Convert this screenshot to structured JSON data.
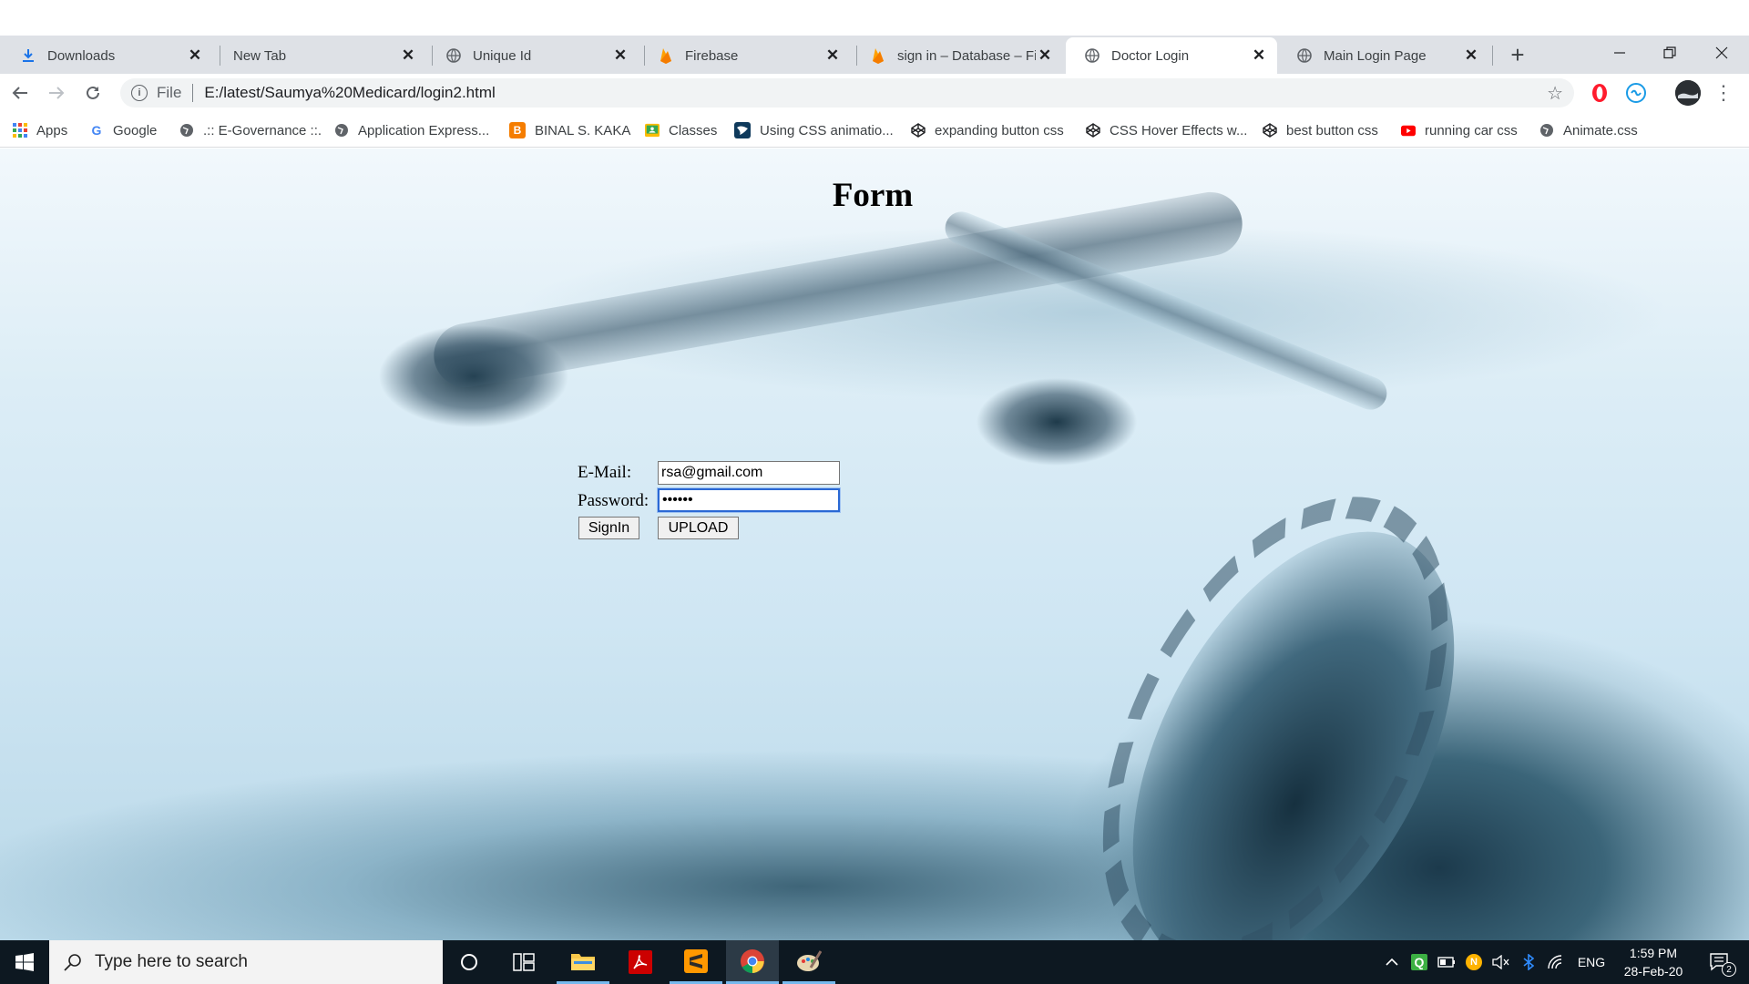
{
  "browser": {
    "tabs": [
      {
        "title": "Downloads",
        "icon": "download-icon"
      },
      {
        "title": "New Tab",
        "icon": "none"
      },
      {
        "title": "Unique Id",
        "icon": "globe-icon"
      },
      {
        "title": "Firebase",
        "icon": "firebase-icon"
      },
      {
        "title": "sign in – Database – Fir",
        "icon": "firebase-icon"
      },
      {
        "title": "Doctor Login",
        "icon": "globe-icon",
        "active": true
      },
      {
        "title": "Main Login Page",
        "icon": "globe-icon"
      }
    ],
    "address": {
      "scheme": "File",
      "url": "E:/latest/Saumya%20Medicard/login2.html"
    },
    "bookmarks": [
      {
        "label": "Apps",
        "icon": "apps-grid-icon"
      },
      {
        "label": "Google",
        "icon": "google-icon"
      },
      {
        "label": ".:: E-Governance ::.",
        "icon": "globe-icon"
      },
      {
        "label": "Application Express...",
        "icon": "globe-icon"
      },
      {
        "label": "BINAL S. KAKA",
        "icon": "blogger-icon"
      },
      {
        "label": "Classes",
        "icon": "classroom-icon"
      },
      {
        "label": "Using CSS animatio...",
        "icon": "mdn-icon"
      },
      {
        "label": "expanding button css",
        "icon": "codepen-icon"
      },
      {
        "label": "CSS Hover Effects w...",
        "icon": "codepen-icon"
      },
      {
        "label": "best button css",
        "icon": "codepen-icon"
      },
      {
        "label": "running car css",
        "icon": "youtube-icon"
      },
      {
        "label": "Animate.css",
        "icon": "globe-icon"
      }
    ]
  },
  "page": {
    "title": "Form",
    "email_label": "E-Mail:",
    "email_value": "rsa@gmail.com",
    "password_label": "Password:",
    "password_value": "••••••",
    "signin_label": "SignIn",
    "upload_label": "UPLOAD"
  },
  "taskbar": {
    "search_placeholder": "Type here to search",
    "language": "ENG",
    "time": "1:59 PM",
    "date": "28-Feb-20",
    "notification_count": "2"
  },
  "colors": {
    "tabstrip": "#dee1e6",
    "focus_ring": "#2a68d4",
    "taskbar": "#0d1821",
    "taskbar_accent": "#76b9ed"
  }
}
